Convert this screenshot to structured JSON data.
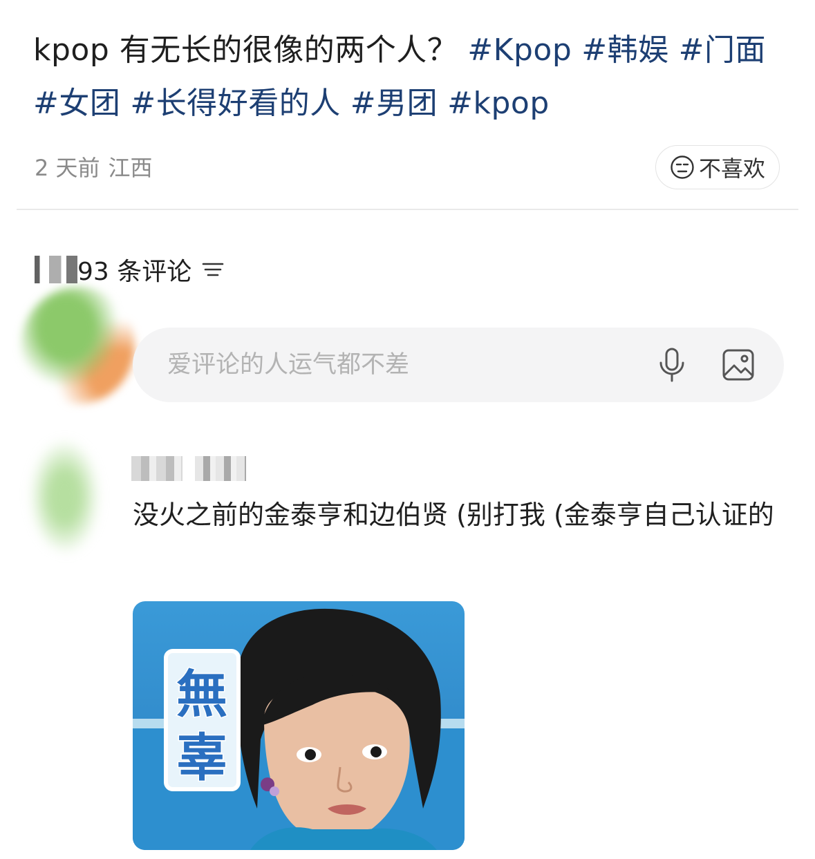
{
  "post": {
    "question": "kpop 有无长的很像的两个人？",
    "tags": [
      "#Kpop",
      "#韩娱",
      "#门面",
      "#女团",
      "#长得好看的人",
      "#男团",
      "#kpop"
    ],
    "time": "2 天前",
    "location": "江西",
    "dislike_label": "不喜欢"
  },
  "comments_header": {
    "count_visible": "93 条评论"
  },
  "comment_box": {
    "placeholder": "爱评论的人运气都不差"
  },
  "comment": {
    "text": "没火之前的金泰亨和边伯贤 (别打我 (金泰亨自己认证的",
    "image_caption": "無辜"
  },
  "colors": {
    "tag": "#1d3f73",
    "meta": "#8a8a8a",
    "input_bg": "#f4f4f5",
    "image_bg": "#2f8fd0"
  },
  "icons": [
    "neutral-face-icon",
    "sort-icon",
    "microphone-icon",
    "image-icon"
  ]
}
